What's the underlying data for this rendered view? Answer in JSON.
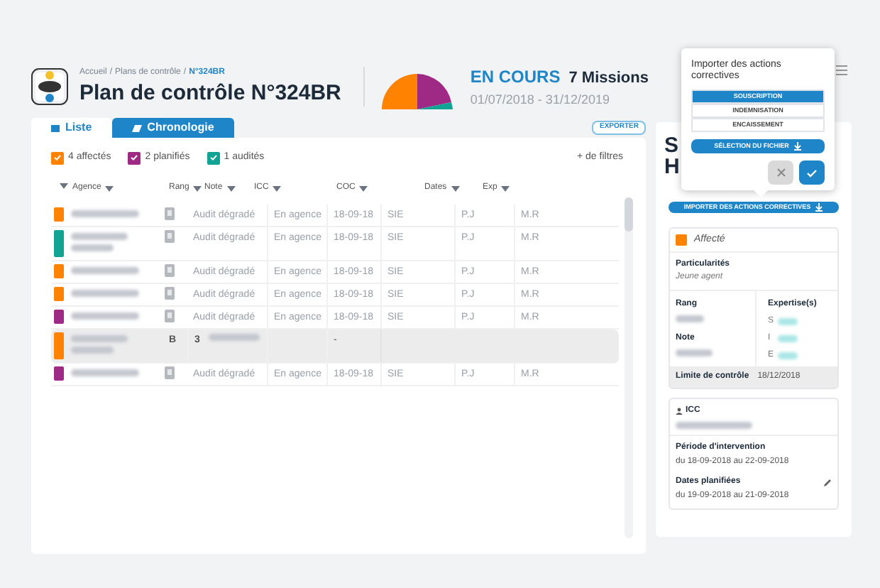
{
  "header": {
    "breadcrumb": [
      {
        "label": "Accueil",
        "current": false
      },
      {
        "label": "Plans de contrôle",
        "current": false
      },
      {
        "label": "N°324BR",
        "current": true
      }
    ],
    "separator": "/",
    "title": "Plan de contrôle N°324BR",
    "status": "EN COURS",
    "missions": "7 Missions",
    "period": "01/07/2018 - 31/12/2019"
  },
  "tabs": [
    {
      "label": "Liste",
      "selected": false
    },
    {
      "label": "Chronologie",
      "selected": true
    }
  ],
  "export_button": "EXPORTER",
  "filters": [
    {
      "label": "4 affectés",
      "checked": true,
      "color": "#ff8200"
    },
    {
      "label": "2 planifiés",
      "checked": true,
      "color": "#9e2a85"
    },
    {
      "label": "1 audités",
      "checked": true,
      "color": "#11a394"
    }
  ],
  "more_filters": "+ de filtres",
  "table": {
    "columns": [
      "Agence",
      "Rang",
      "Note",
      "ICC",
      "COC",
      "Dates",
      "Exp"
    ],
    "rows": [
      {
        "kind": "audit",
        "color": "#ff8200",
        "selected": false,
        "note": "Audit dégradé",
        "icc": "En agence",
        "coc": "18-09-18",
        "column_6": "SIE",
        "dates": "P.J",
        "exp": "M.R",
        "tall": false
      },
      {
        "kind": "audit",
        "color": "#11a394",
        "selected": false,
        "note": "Audit dégradé",
        "icc": "En agence",
        "coc": "18-09-18",
        "column_6": "SIE",
        "dates": "P.J",
        "exp": "M.R",
        "tall": true
      },
      {
        "kind": "audit",
        "color": "#ff8200",
        "selected": false,
        "note": "Audit dégradé",
        "icc": "En agence",
        "coc": "18-09-18",
        "column_6": "SIE",
        "dates": "P.J",
        "exp": "M.R",
        "tall": false
      },
      {
        "kind": "audit",
        "color": "#ff8200",
        "selected": false,
        "note": "Audit dégradé",
        "icc": "En agence",
        "coc": "18-09-18",
        "column_6": "SIE",
        "dates": "P.J",
        "exp": "M.R",
        "tall": false
      },
      {
        "kind": "audit",
        "color": "#9e2a85",
        "selected": false,
        "note": "Audit dégradé",
        "icc": "En agence",
        "coc": "18-09-18",
        "column_6": "SIE",
        "dates": "P.J",
        "exp": "M.R",
        "tall": false
      },
      {
        "kind": "assigned",
        "color": "#ff8200",
        "selected": true,
        "rang": "B",
        "note": "3",
        "coc": "-",
        "tall": true
      },
      {
        "kind": "audit",
        "color": "#9e2a85",
        "selected": false,
        "note": "Audit dégradé",
        "icc": "En agence",
        "coc": "18-09-18",
        "column_6": "SIE",
        "dates": "P.J",
        "exp": "M.R",
        "tall": false
      }
    ]
  },
  "detail": {
    "title_lines": [
      "S",
      "H"
    ],
    "import_button": "IMPORTER DES ACTIONS CORRECTIVES",
    "status": {
      "label": "Affecté",
      "color": "#ff8200"
    },
    "particularites": {
      "label": "Particularités",
      "value": "Jeune agent"
    },
    "rang_label": "Rang",
    "note_label": "Note",
    "expertise_label": "Expertise(s)",
    "expertise_letters": [
      "S",
      "I",
      "E"
    ],
    "limite": {
      "label": "Limite de contrôle",
      "value": "18/12/2018"
    },
    "icc_label": "ICC",
    "periode": {
      "label": "Période d'intervention",
      "value": "du 18-09-2018 au 22-09-2018"
    },
    "dates_planifiees": {
      "label": "Dates planifiées",
      "value": "du 19-09-2018 au 21-09-2018"
    }
  },
  "popup": {
    "title": "Importer des actions correctives",
    "options": [
      {
        "label": "SOUSCRIPTION",
        "selected": true
      },
      {
        "label": "INDEMNISATION",
        "selected": false
      },
      {
        "label": "ENCAISSEMENT",
        "selected": false
      }
    ],
    "file_button": "SÉLECTION DU FICHIER"
  }
}
